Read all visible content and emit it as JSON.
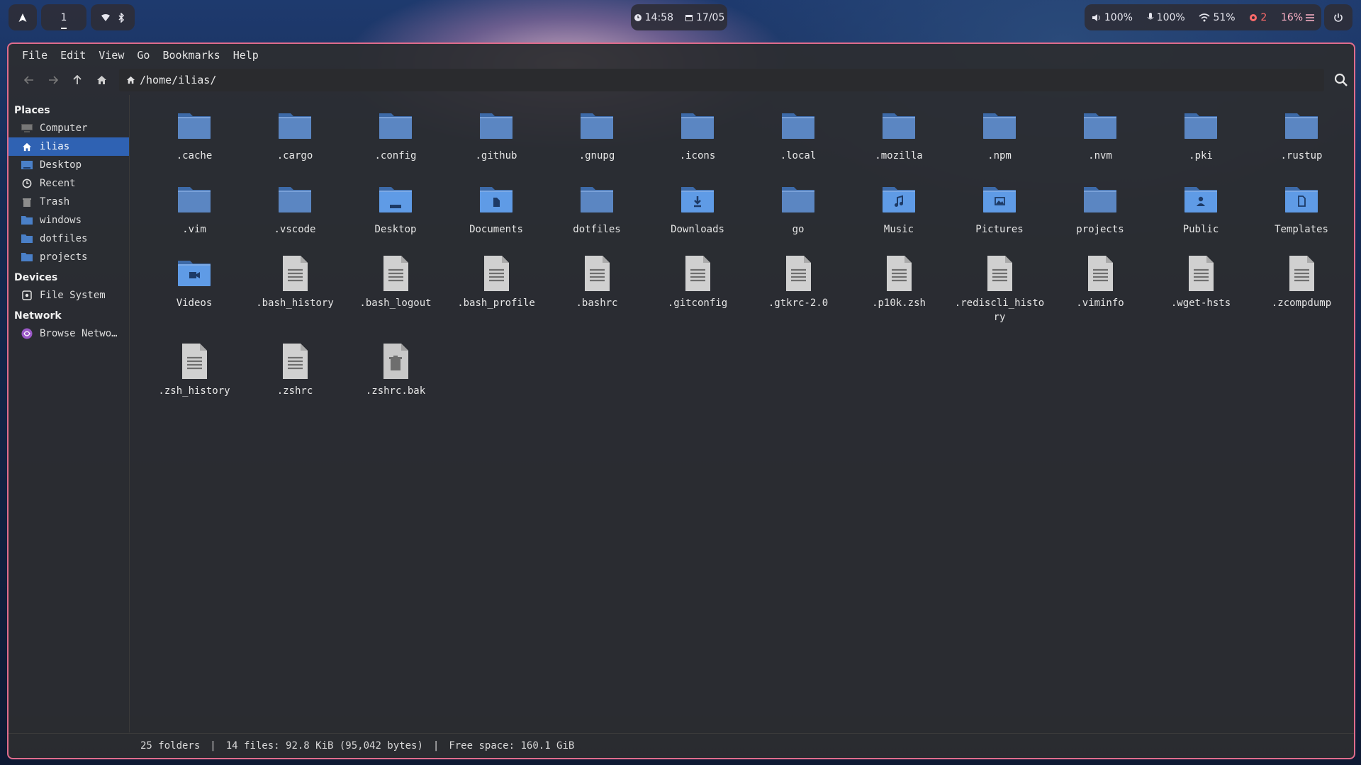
{
  "topbar": {
    "workspace": "1",
    "time": "14:58",
    "date": "17/05",
    "volume": "100%",
    "mic": "100%",
    "wifi": "51%",
    "notifications": "2",
    "cpu": "16%"
  },
  "menubar": [
    "File",
    "Edit",
    "View",
    "Go",
    "Bookmarks",
    "Help"
  ],
  "path": "/home/ilias/",
  "sidebar": {
    "places_heading": "Places",
    "places": [
      {
        "label": "Computer",
        "icon": "computer-icon"
      },
      {
        "label": "ilias",
        "icon": "home-icon",
        "selected": true
      },
      {
        "label": "Desktop",
        "icon": "desktop-folder-icon"
      },
      {
        "label": "Recent",
        "icon": "clock-icon"
      },
      {
        "label": "Trash",
        "icon": "trash-icon"
      },
      {
        "label": "windows",
        "icon": "folder-icon"
      },
      {
        "label": "dotfiles",
        "icon": "folder-icon"
      },
      {
        "label": "projects",
        "icon": "folder-icon"
      }
    ],
    "devices_heading": "Devices",
    "devices": [
      {
        "label": "File System",
        "icon": "drive-icon"
      }
    ],
    "network_heading": "Network",
    "network": [
      {
        "label": "Browse Netwo…",
        "icon": "network-icon"
      }
    ]
  },
  "files": [
    {
      "name": ".cache",
      "type": "folder"
    },
    {
      "name": ".cargo",
      "type": "folder"
    },
    {
      "name": ".config",
      "type": "folder"
    },
    {
      "name": ".github",
      "type": "folder"
    },
    {
      "name": ".gnupg",
      "type": "folder"
    },
    {
      "name": ".icons",
      "type": "folder"
    },
    {
      "name": ".local",
      "type": "folder"
    },
    {
      "name": ".mozilla",
      "type": "folder"
    },
    {
      "name": ".npm",
      "type": "folder"
    },
    {
      "name": ".nvm",
      "type": "folder"
    },
    {
      "name": ".pki",
      "type": "folder"
    },
    {
      "name": ".rustup",
      "type": "folder"
    },
    {
      "name": ".vim",
      "type": "folder"
    },
    {
      "name": ".vscode",
      "type": "folder"
    },
    {
      "name": "Desktop",
      "type": "folder-desktop"
    },
    {
      "name": "Documents",
      "type": "folder-documents"
    },
    {
      "name": "dotfiles",
      "type": "folder"
    },
    {
      "name": "Downloads",
      "type": "folder-downloads"
    },
    {
      "name": "go",
      "type": "folder"
    },
    {
      "name": "Music",
      "type": "folder-music"
    },
    {
      "name": "Pictures",
      "type": "folder-pictures"
    },
    {
      "name": "projects",
      "type": "folder"
    },
    {
      "name": "Public",
      "type": "folder-public"
    },
    {
      "name": "Templates",
      "type": "folder-templates"
    },
    {
      "name": "Videos",
      "type": "folder-videos"
    },
    {
      "name": ".bash_history",
      "type": "text"
    },
    {
      "name": ".bash_logout",
      "type": "text"
    },
    {
      "name": ".bash_profile",
      "type": "text"
    },
    {
      "name": ".bashrc",
      "type": "text"
    },
    {
      "name": ".gitconfig",
      "type": "text"
    },
    {
      "name": ".gtkrc-2.0",
      "type": "text"
    },
    {
      "name": ".p10k.zsh",
      "type": "text"
    },
    {
      "name": ".rediscli_history",
      "type": "text"
    },
    {
      "name": ".viminfo",
      "type": "text"
    },
    {
      "name": ".wget-hsts",
      "type": "text"
    },
    {
      "name": ".zcompdump",
      "type": "text"
    },
    {
      "name": ".zsh_history",
      "type": "text"
    },
    {
      "name": ".zshrc",
      "type": "text"
    },
    {
      "name": ".zshrc.bak",
      "type": "trash-file"
    }
  ],
  "status": {
    "folders": "25 folders",
    "files": "14 files: 92.8 KiB (95,042 bytes)",
    "free": "Free space: 160.1 GiB",
    "separator": "|"
  },
  "colors": {
    "accent": "#2f62b3",
    "folder": "#4a80c8",
    "border": "#e06c8c"
  }
}
